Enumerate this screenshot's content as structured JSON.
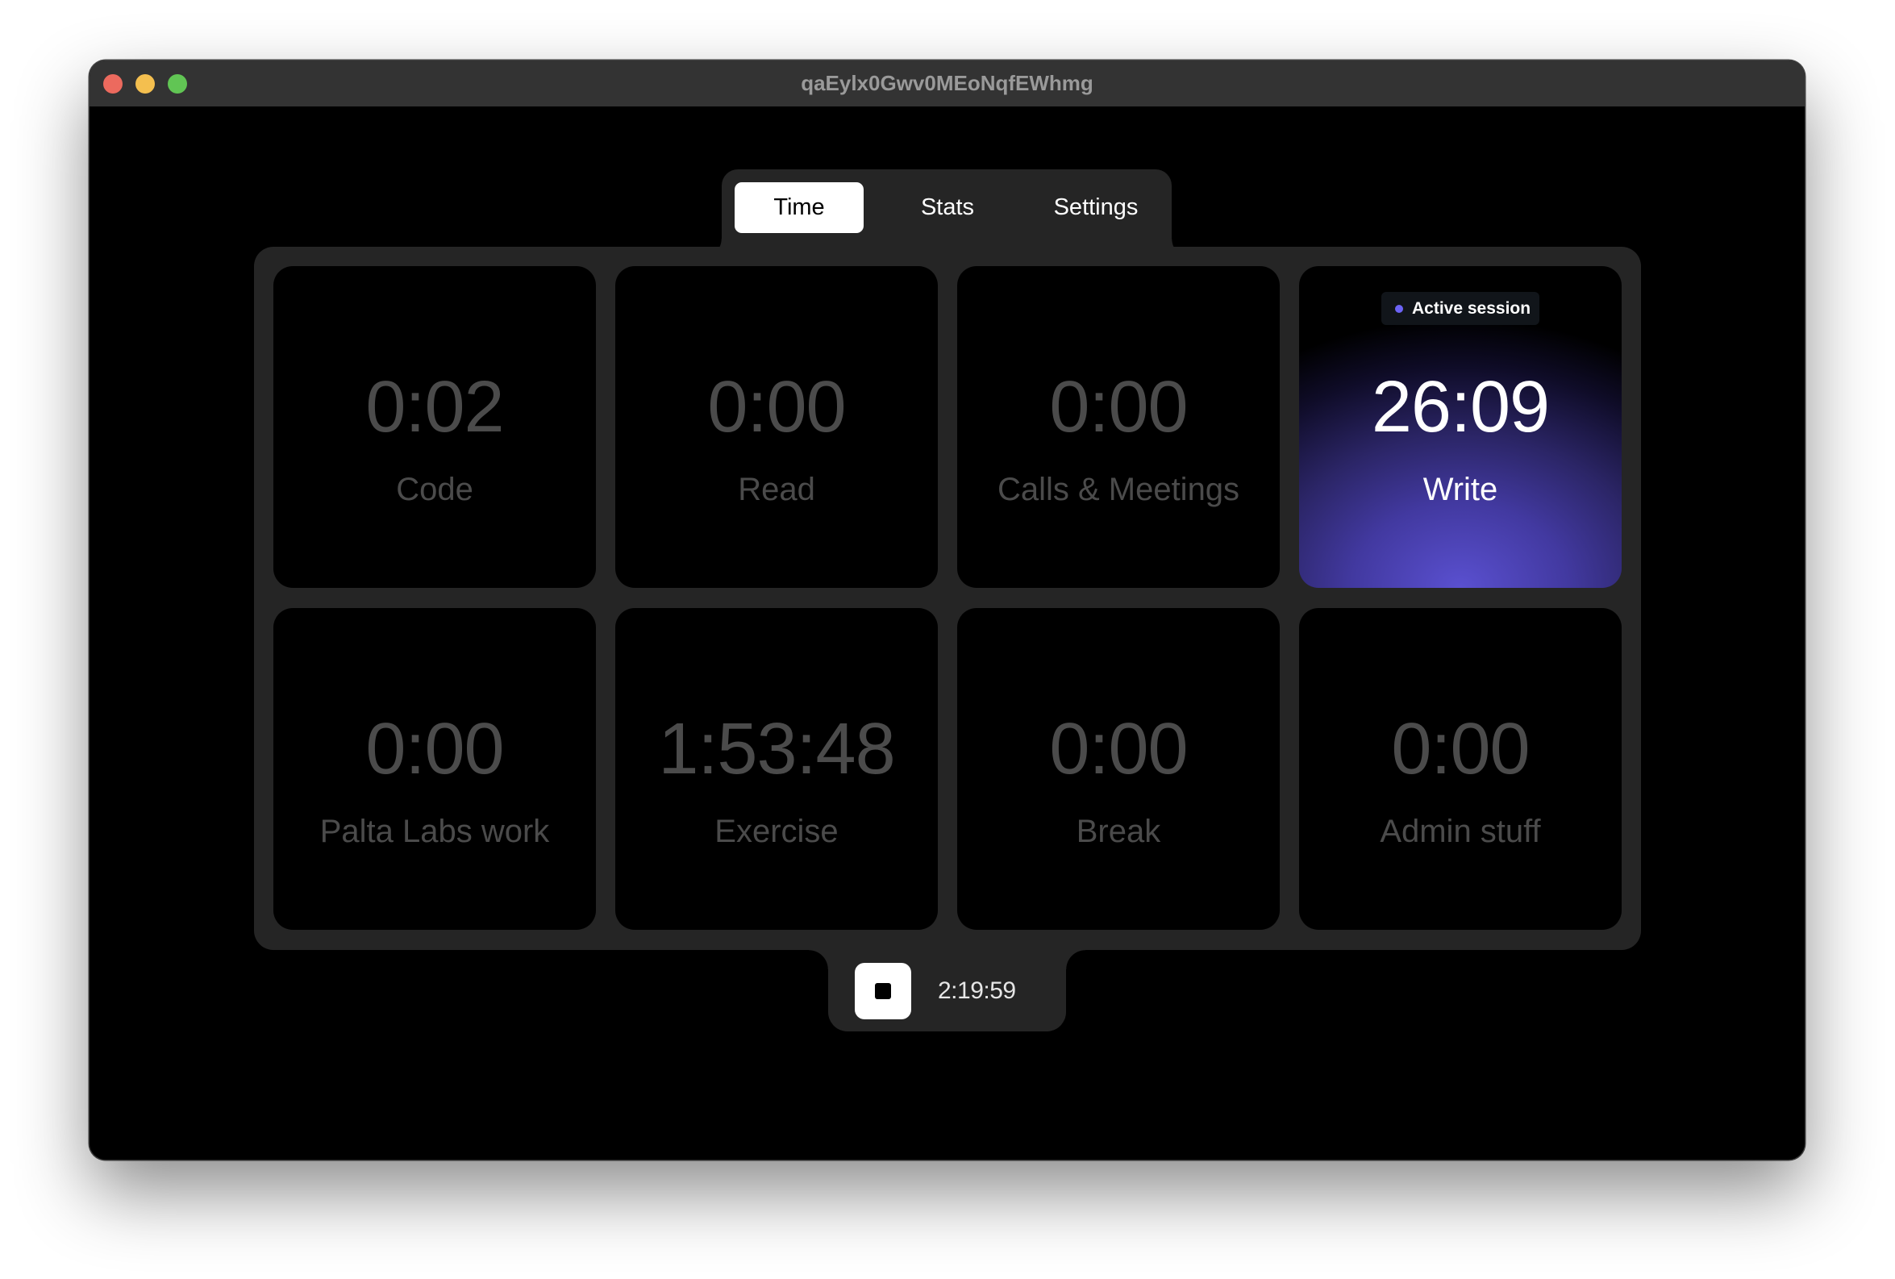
{
  "window": {
    "title": "qaEylx0Gwv0MEoNqfEWhmg",
    "traffic_lights": [
      "close",
      "minimize",
      "zoom"
    ]
  },
  "tabs": [
    {
      "label": "Time",
      "active": true
    },
    {
      "label": "Stats",
      "active": false
    },
    {
      "label": "Settings",
      "active": false
    }
  ],
  "categories": [
    {
      "time": "0:02",
      "label": "Code",
      "active": false
    },
    {
      "time": "0:00",
      "label": "Read",
      "active": false
    },
    {
      "time": "0:00",
      "label": "Calls & Meetings",
      "active": false
    },
    {
      "time": "26:09",
      "label": "Write",
      "active": true
    },
    {
      "time": "0:00",
      "label": "Palta Labs work",
      "active": false
    },
    {
      "time": "1:53:48",
      "label": "Exercise",
      "active": false
    },
    {
      "time": "0:00",
      "label": "Break",
      "active": false
    },
    {
      "time": "0:00",
      "label": "Admin stuff",
      "active": false
    }
  ],
  "active_badge": {
    "text": "Active session",
    "dot_color": "#6c63f5"
  },
  "footer": {
    "stop_icon": "stop-icon",
    "total_time": "2:19:59"
  },
  "colors": {
    "accent": "#5a50d0",
    "panel": "#252525",
    "inactive_text": "#4b4b4b"
  }
}
